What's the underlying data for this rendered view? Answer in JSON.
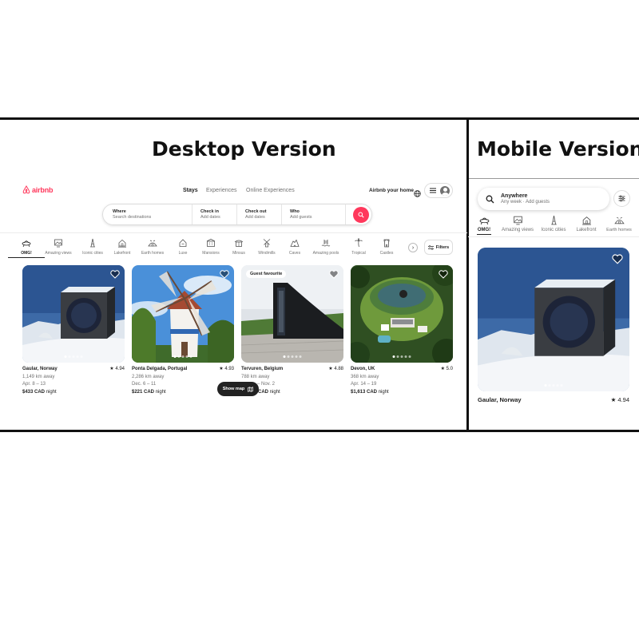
{
  "titles": {
    "desktop": "Desktop Version",
    "mobile": "Mobile Version"
  },
  "brand": {
    "name": "airbnb",
    "color": "#ff385c"
  },
  "desktop": {
    "nav": {
      "stays": "Stays",
      "experiences": "Experiences",
      "online": "Online Experiences"
    },
    "host_link": "Airbnb your home",
    "search": {
      "where_label": "Where",
      "where_placeholder": "Search destinations",
      "checkin_label": "Check in",
      "checkin_value": "Add dates",
      "checkout_label": "Check out",
      "checkout_value": "Add dates",
      "who_label": "Who",
      "who_value": "Add guests"
    },
    "categories": [
      "OMG!",
      "Amazing views",
      "Iconic cities",
      "Lakefront",
      "Earth homes",
      "Luxe",
      "Mansions",
      "Minsus",
      "Windmills",
      "Caves",
      "Amazing pools",
      "Tropical",
      "Castles"
    ],
    "active_category": "OMG!",
    "filters_label": "Filters",
    "listings": [
      {
        "location": "Gaular, Norway",
        "rating": "4.94",
        "distance": "1,149 km away",
        "dates": "Apr. 8 – 13",
        "price": "$433 CAD",
        "unit": "night",
        "badge": ""
      },
      {
        "location": "Ponta Delgada, Portugal",
        "rating": "4.93",
        "distance": "2,286 km away",
        "dates": "Dec. 6 – 11",
        "price": "$221 CAD",
        "unit": "night",
        "badge": ""
      },
      {
        "location": "Tervuren, Belgium",
        "rating": "4.88",
        "distance": "788 km away",
        "dates": "– Nov. 2",
        "price": "CAD",
        "unit": "night",
        "badge": "Guest favourite"
      },
      {
        "location": "Devon, UK",
        "rating": "5.0",
        "distance": "368 km away",
        "dates": "Apr. 14 – 19",
        "price": "$1,613 CAD",
        "unit": "night",
        "badge": ""
      }
    ],
    "show_map": "Show map"
  },
  "mobile": {
    "search_title": "Anywhere",
    "search_sub": "Any week · Add guests",
    "categories": [
      "OMG!",
      "Amazing views",
      "Iconic cities",
      "Lakefront",
      "Earth homes"
    ],
    "listing": {
      "location": "Gaular, Norway",
      "rating": "4.94"
    }
  }
}
